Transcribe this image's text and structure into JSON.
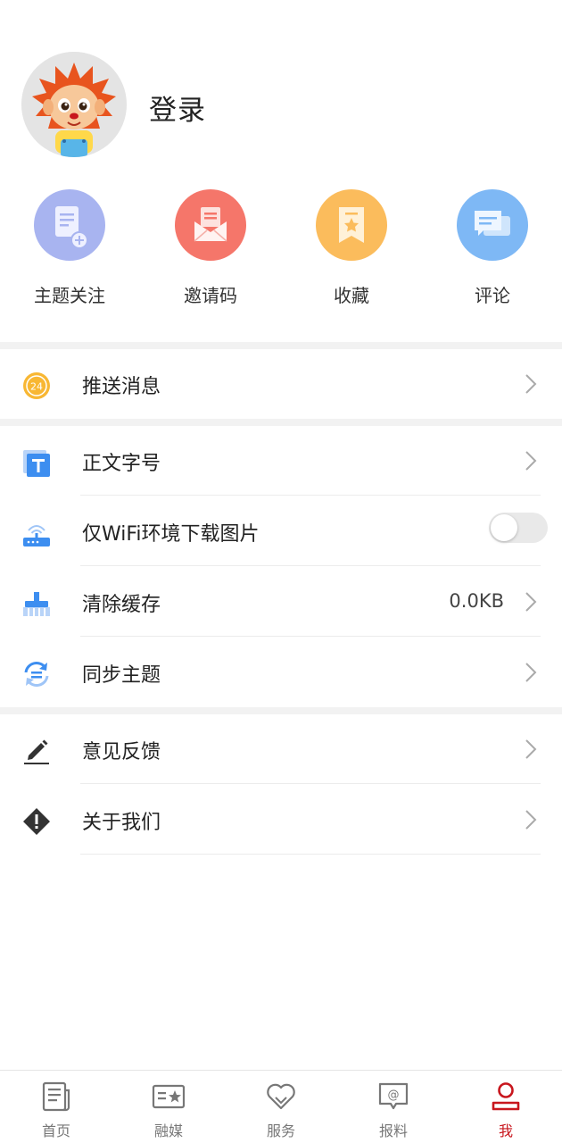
{
  "profile": {
    "login_label": "登录"
  },
  "quick_actions": [
    {
      "label": "主题关注",
      "icon": "document-add-icon",
      "color": "#a8b4f0"
    },
    {
      "label": "邀请码",
      "icon": "envelope-icon",
      "color": "#f5766a"
    },
    {
      "label": "收藏",
      "icon": "bookmark-icon",
      "color": "#fbbc5c"
    },
    {
      "label": "评论",
      "icon": "chat-icon",
      "color": "#7eb8f5"
    }
  ],
  "menu": {
    "push": {
      "label": "推送消息",
      "icon": "clock-24-icon"
    },
    "font_size": {
      "label": "正文字号",
      "icon": "text-size-icon"
    },
    "wifi_images": {
      "label": "仅WiFi环境下载图片",
      "icon": "wifi-router-icon",
      "enabled": false
    },
    "clear_cache": {
      "label": "清除缓存",
      "value": "0.0KB",
      "icon": "broom-icon"
    },
    "sync_theme": {
      "label": "同步主题",
      "icon": "sync-icon"
    },
    "feedback": {
      "label": "意见反馈",
      "icon": "pencil-icon"
    },
    "about": {
      "label": "关于我们",
      "icon": "warning-diamond-icon"
    }
  },
  "tabbar": {
    "items": [
      {
        "label": "首页",
        "icon": "newspaper-icon"
      },
      {
        "label": "融媒",
        "icon": "media-card-icon"
      },
      {
        "label": "服务",
        "icon": "heart-icon"
      },
      {
        "label": "报料",
        "icon": "at-message-icon"
      },
      {
        "label": "我",
        "icon": "person-icon"
      }
    ],
    "active_index": 4,
    "active_color": "#c8161d",
    "inactive_color": "#777777"
  }
}
